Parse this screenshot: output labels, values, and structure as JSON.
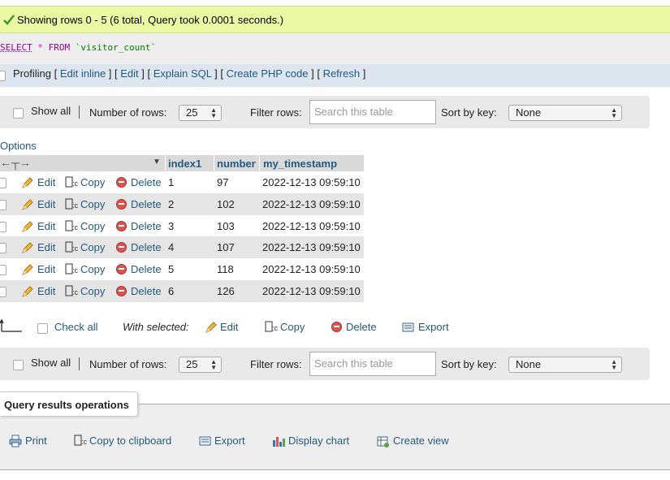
{
  "success_message": "Showing rows 0 - 5 (6 total, Query took 0.0001 seconds.)",
  "sql": {
    "kw": "SELECT",
    "op": "*",
    "from": "FROM",
    "table": "`visitor_count`"
  },
  "profiling": {
    "label": "Profiling",
    "links": [
      "Edit inline",
      "Edit",
      "Explain SQL",
      "Create PHP code",
      "Refresh"
    ]
  },
  "nav": {
    "show_all": "Show all",
    "num_rows_label": "Number of rows:",
    "num_rows_value": "25",
    "filter_label": "Filter rows:",
    "filter_placeholder": "Search this table",
    "sort_label": "Sort by key:",
    "sort_value": "None"
  },
  "options_label": "Options",
  "columns": [
    "index1",
    "number",
    "my_timestamp"
  ],
  "row_actions": {
    "edit": "Edit",
    "copy": "Copy",
    "delete": "Delete"
  },
  "rows": [
    {
      "index1": "1",
      "number": "97",
      "my_timestamp": "2022-12-13 09:59:10"
    },
    {
      "index1": "2",
      "number": "102",
      "my_timestamp": "2022-12-13 09:59:10"
    },
    {
      "index1": "3",
      "number": "103",
      "my_timestamp": "2022-12-13 09:59:10"
    },
    {
      "index1": "4",
      "number": "107",
      "my_timestamp": "2022-12-13 09:59:10"
    },
    {
      "index1": "5",
      "number": "118",
      "my_timestamp": "2022-12-13 09:59:10"
    },
    {
      "index1": "6",
      "number": "126",
      "my_timestamp": "2022-12-13 09:59:10"
    }
  ],
  "bulk": {
    "check_all": "Check all",
    "with_selected": "With selected:",
    "edit": "Edit",
    "copy": "Copy",
    "delete": "Delete",
    "export": "Export"
  },
  "qro": {
    "title": "Query results operations",
    "print": "Print",
    "copy_clipboard": "Copy to clipboard",
    "export": "Export",
    "display_chart": "Display chart",
    "create_view": "Create view"
  },
  "colors": {
    "success_bg": "#ebf8a4",
    "link": "#235a81",
    "row_alt": "#e5e5e5"
  }
}
